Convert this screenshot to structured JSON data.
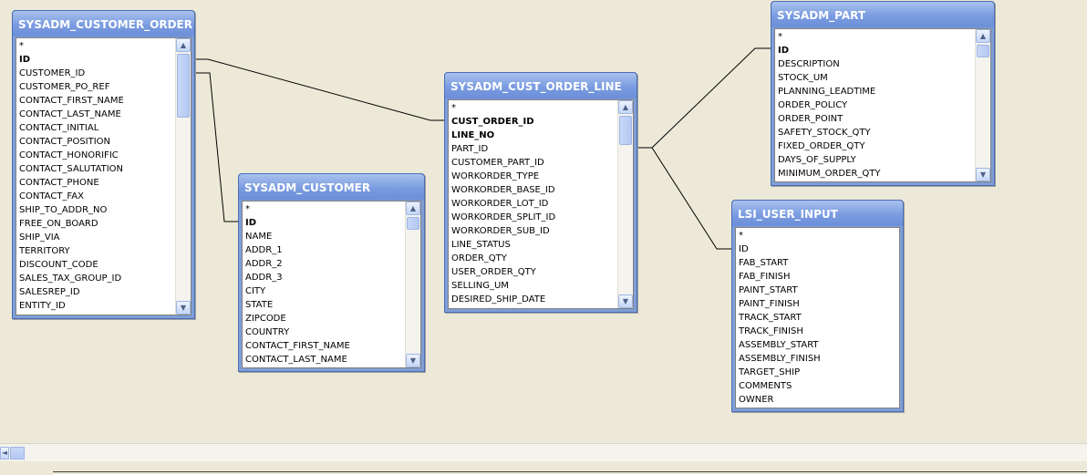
{
  "tables": {
    "customer_order": {
      "title": "SYSADM_CUSTOMER_ORDER",
      "fields": [
        {
          "name": "*",
          "pk": false
        },
        {
          "name": "ID",
          "pk": true
        },
        {
          "name": "CUSTOMER_ID",
          "pk": false
        },
        {
          "name": "CUSTOMER_PO_REF",
          "pk": false
        },
        {
          "name": "CONTACT_FIRST_NAME",
          "pk": false
        },
        {
          "name": "CONTACT_LAST_NAME",
          "pk": false
        },
        {
          "name": "CONTACT_INITIAL",
          "pk": false
        },
        {
          "name": "CONTACT_POSITION",
          "pk": false
        },
        {
          "name": "CONTACT_HONORIFIC",
          "pk": false
        },
        {
          "name": "CONTACT_SALUTATION",
          "pk": false
        },
        {
          "name": "CONTACT_PHONE",
          "pk": false
        },
        {
          "name": "CONTACT_FAX",
          "pk": false
        },
        {
          "name": "SHIP_TO_ADDR_NO",
          "pk": false
        },
        {
          "name": "FREE_ON_BOARD",
          "pk": false
        },
        {
          "name": "SHIP_VIA",
          "pk": false
        },
        {
          "name": "TERRITORY",
          "pk": false
        },
        {
          "name": "DISCOUNT_CODE",
          "pk": false
        },
        {
          "name": "SALES_TAX_GROUP_ID",
          "pk": false
        },
        {
          "name": "SALESREP_ID",
          "pk": false
        },
        {
          "name": "ENTITY_ID",
          "pk": false
        }
      ]
    },
    "customer": {
      "title": "SYSADM_CUSTOMER",
      "fields": [
        {
          "name": "*",
          "pk": false
        },
        {
          "name": "ID",
          "pk": true
        },
        {
          "name": "NAME",
          "pk": false
        },
        {
          "name": "ADDR_1",
          "pk": false
        },
        {
          "name": "ADDR_2",
          "pk": false
        },
        {
          "name": "ADDR_3",
          "pk": false
        },
        {
          "name": "CITY",
          "pk": false
        },
        {
          "name": "STATE",
          "pk": false
        },
        {
          "name": "ZIPCODE",
          "pk": false
        },
        {
          "name": "COUNTRY",
          "pk": false
        },
        {
          "name": "CONTACT_FIRST_NAME",
          "pk": false
        },
        {
          "name": "CONTACT_LAST_NAME",
          "pk": false
        }
      ]
    },
    "cust_order_line": {
      "title": "SYSADM_CUST_ORDER_LINE",
      "fields": [
        {
          "name": "*",
          "pk": false
        },
        {
          "name": "CUST_ORDER_ID",
          "pk": true
        },
        {
          "name": "LINE_NO",
          "pk": true
        },
        {
          "name": "PART_ID",
          "pk": false
        },
        {
          "name": "CUSTOMER_PART_ID",
          "pk": false
        },
        {
          "name": "WORKORDER_TYPE",
          "pk": false
        },
        {
          "name": "WORKORDER_BASE_ID",
          "pk": false
        },
        {
          "name": "WORKORDER_LOT_ID",
          "pk": false
        },
        {
          "name": "WORKORDER_SPLIT_ID",
          "pk": false
        },
        {
          "name": "WORKORDER_SUB_ID",
          "pk": false
        },
        {
          "name": "LINE_STATUS",
          "pk": false
        },
        {
          "name": "ORDER_QTY",
          "pk": false
        },
        {
          "name": "USER_ORDER_QTY",
          "pk": false
        },
        {
          "name": "SELLING_UM",
          "pk": false
        },
        {
          "name": "DESIRED_SHIP_DATE",
          "pk": false
        }
      ]
    },
    "part": {
      "title": "SYSADM_PART",
      "fields": [
        {
          "name": "*",
          "pk": false
        },
        {
          "name": "ID",
          "pk": true
        },
        {
          "name": "DESCRIPTION",
          "pk": false
        },
        {
          "name": "STOCK_UM",
          "pk": false
        },
        {
          "name": "PLANNING_LEADTIME",
          "pk": false
        },
        {
          "name": "ORDER_POLICY",
          "pk": false
        },
        {
          "name": "ORDER_POINT",
          "pk": false
        },
        {
          "name": "SAFETY_STOCK_QTY",
          "pk": false
        },
        {
          "name": "FIXED_ORDER_QTY",
          "pk": false
        },
        {
          "name": "DAYS_OF_SUPPLY",
          "pk": false
        },
        {
          "name": "MINIMUM_ORDER_QTY",
          "pk": false
        }
      ]
    },
    "lsi_user_input": {
      "title": "LSI_USER_INPUT",
      "fields": [
        {
          "name": "*",
          "pk": false
        },
        {
          "name": "ID",
          "pk": false
        },
        {
          "name": "FAB_START",
          "pk": false
        },
        {
          "name": "FAB_FINISH",
          "pk": false
        },
        {
          "name": "PAINT_START",
          "pk": false
        },
        {
          "name": "PAINT_FINISH",
          "pk": false
        },
        {
          "name": "TRACK_START",
          "pk": false
        },
        {
          "name": "TRACK_FINISH",
          "pk": false
        },
        {
          "name": "ASSEMBLY_START",
          "pk": false
        },
        {
          "name": "ASSEMBLY_FINISH",
          "pk": false
        },
        {
          "name": "TARGET_SHIP",
          "pk": false
        },
        {
          "name": "COMMENTS",
          "pk": false
        },
        {
          "name": "OWNER",
          "pk": false
        }
      ]
    }
  },
  "relationships": [
    {
      "from": "SYSADM_CUSTOMER_ORDER.ID",
      "to": "SYSADM_CUST_ORDER_LINE.CUST_ORDER_ID"
    },
    {
      "from": "SYSADM_CUSTOMER_ORDER.CUSTOMER_ID",
      "to": "SYSADM_CUSTOMER.ID"
    },
    {
      "from": "SYSADM_CUST_ORDER_LINE.PART_ID",
      "to": "SYSADM_PART.ID"
    },
    {
      "from": "SYSADM_CUST_ORDER_LINE.PART_ID",
      "to": "LSI_USER_INPUT.ID"
    }
  ],
  "icons": {
    "scroll_up": "▲",
    "scroll_down": "▼",
    "scroll_left": "◄"
  },
  "colors": {
    "title_bar": "#7a9be0",
    "canvas": "#ece9d8"
  }
}
